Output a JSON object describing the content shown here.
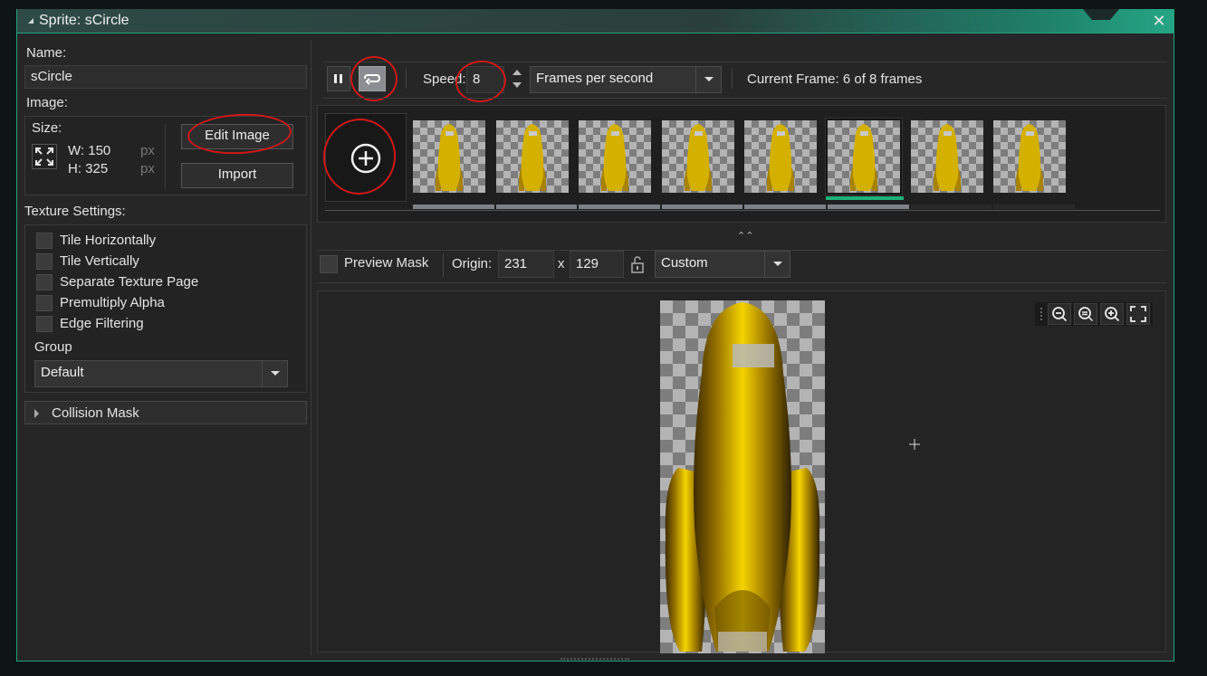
{
  "window": {
    "title": "Sprite: sCircle"
  },
  "left": {
    "name_label": "Name:",
    "name_value": "sCircle",
    "image_label": "Image:",
    "size_label": "Size:",
    "width_label": "W: 150",
    "height_label": "H: 325",
    "unit_px": "px",
    "edit_image": "Edit Image",
    "import": "Import",
    "texture_label": "Texture Settings:",
    "options": [
      "Tile Horizontally",
      "Tile Vertically",
      "Separate Texture Page",
      "Premultiply Alpha",
      "Edge Filtering"
    ],
    "group_label": "Group",
    "group_value": "Default",
    "collision_mask": "Collision Mask"
  },
  "toolbar": {
    "speed_label": "Speed:",
    "speed_value": "8",
    "speed_unit": "Frames per second",
    "current_frame": "Current Frame: 6 of 8 frames"
  },
  "frames": {
    "count": 8,
    "selected": 6
  },
  "mask_bar": {
    "preview_mask": "Preview Mask",
    "origin_label": "Origin:",
    "origin_x": "231",
    "x_sep": "x",
    "origin_y": "129",
    "origin_mode": "Custom"
  },
  "colors": {
    "accent": "#1fa47a",
    "annotation": "#d01818",
    "selected_frame": "#1db07a"
  },
  "icons": [
    "pause-icon",
    "loop-icon",
    "add-frame-icon",
    "lock-icon",
    "zoom-out-icon",
    "zoom-reset-icon",
    "zoom-in-icon",
    "fit-icon"
  ]
}
